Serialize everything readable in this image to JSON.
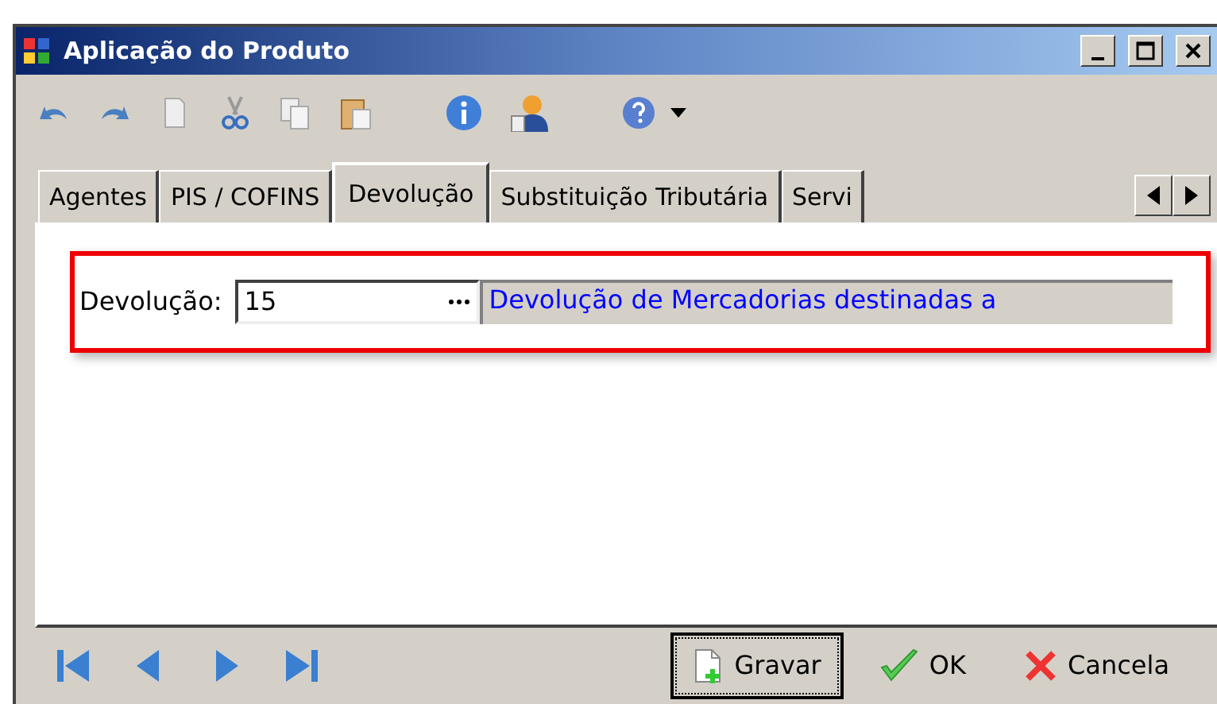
{
  "window": {
    "title": "Aplicação do Produto"
  },
  "tabs": [
    {
      "label": "Agentes",
      "selected": false
    },
    {
      "label": "PIS / COFINS",
      "selected": false
    },
    {
      "label": "Devolução",
      "selected": true
    },
    {
      "label": "Substituição Tributária",
      "selected": false
    },
    {
      "label": "Servi",
      "selected": false
    }
  ],
  "field": {
    "label": "Devolução:",
    "value": "15",
    "description": "Devolução de Mercadorias destinadas a"
  },
  "buttons": [
    {
      "label": "Gravar",
      "kind": "save",
      "focused": true
    },
    {
      "label": "OK",
      "kind": "ok",
      "focused": false
    },
    {
      "label": "Cancela",
      "kind": "cancel",
      "focused": false
    }
  ]
}
